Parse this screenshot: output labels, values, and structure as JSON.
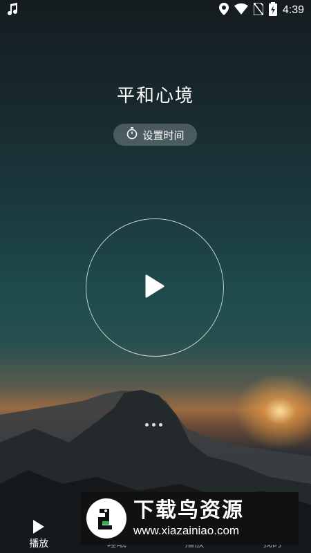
{
  "status_bar": {
    "time": "4:39",
    "icons": [
      "music-note-icon",
      "location-icon",
      "wifi-icon",
      "no-sim-icon",
      "battery-charging-icon"
    ]
  },
  "main": {
    "title": "平和心境",
    "timer_button_label": "设置时间",
    "timer_icon": "stopwatch-icon",
    "play_icon": "play-icon"
  },
  "bottom_nav": {
    "items": [
      {
        "label": "播放",
        "icon": "play-triangle-icon",
        "active": true
      },
      {
        "label": "睡眠",
        "icon": "",
        "active": false
      },
      {
        "label": "播放",
        "icon": "",
        "active": false
      },
      {
        "label": "我的",
        "icon": "",
        "active": false
      }
    ]
  },
  "watermark": {
    "title": "下载鸟资源",
    "url": "www.xiazainiao.com"
  },
  "colors": {
    "sky_top": "#151c20",
    "sky_mid": "#1e4a4c",
    "sunset": "#9b6a42",
    "nav_bg": "#14181c"
  }
}
